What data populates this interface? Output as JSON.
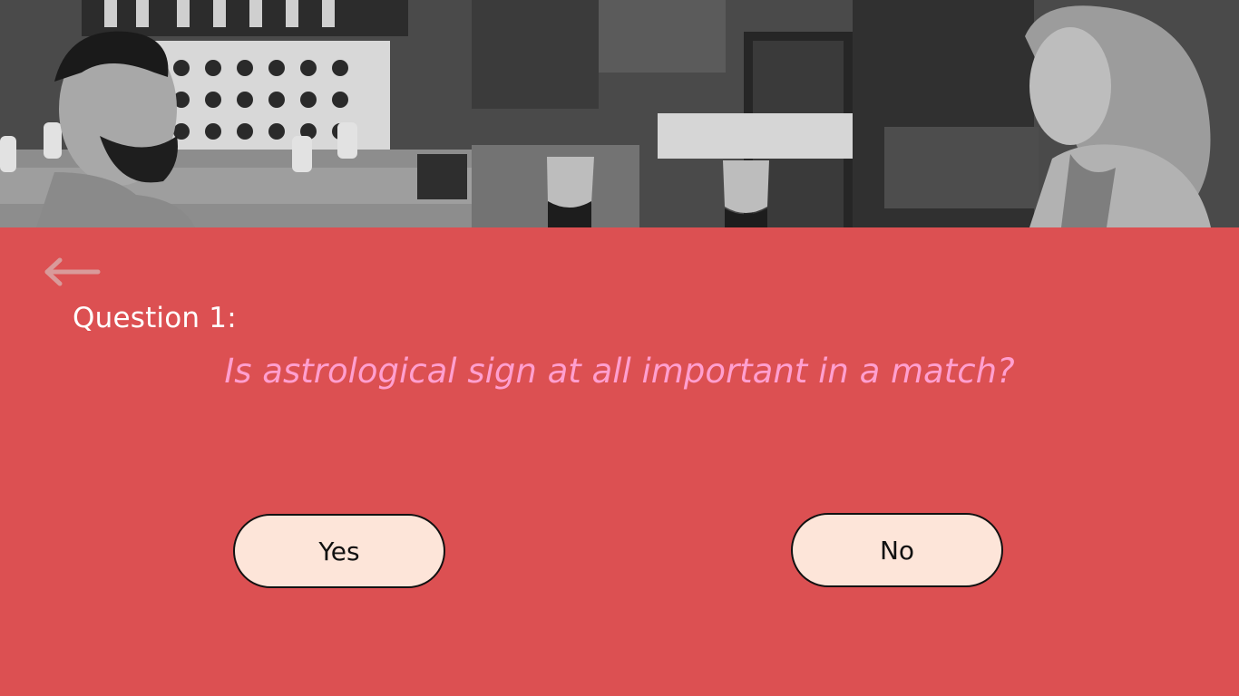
{
  "hero": {
    "image_icon": "restaurant-date-photo"
  },
  "nav": {
    "back_icon": "arrow-left-icon"
  },
  "question": {
    "label": "Question 1:",
    "text": "Is astrological sign at all important in a match?"
  },
  "answers": {
    "yes_label": "Yes",
    "no_label": "No"
  },
  "colors": {
    "background": "#dc5052",
    "question_text": "#ff9fcf",
    "button_fill": "#fde5d9",
    "button_border": "#111111",
    "label_text": "#ffffff",
    "back_arrow": "#d99a9a"
  }
}
